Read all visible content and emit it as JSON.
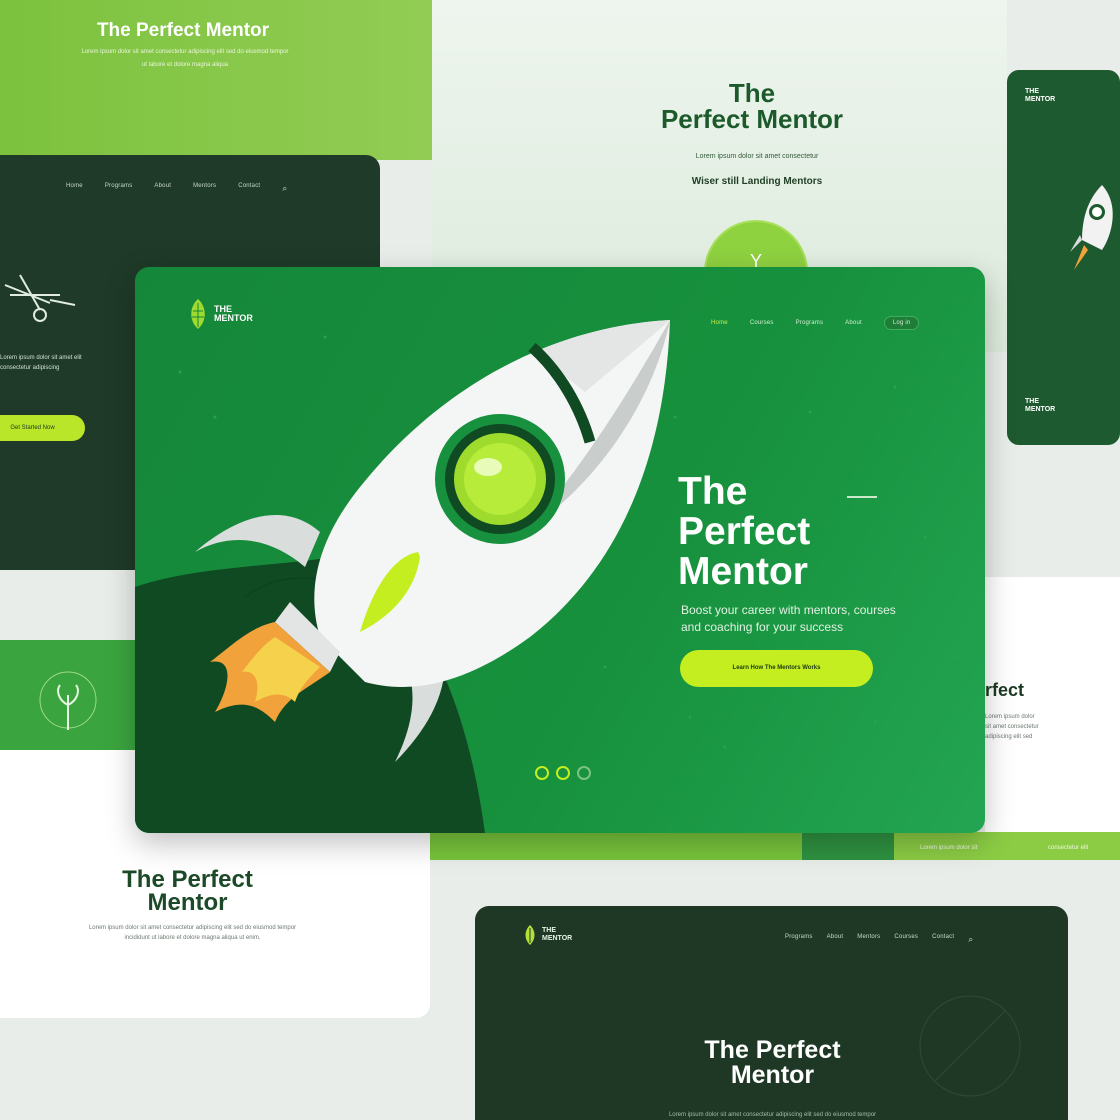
{
  "brand": {
    "title": "The Perfect Mentor",
    "logo_line1": "THE",
    "logo_line2": "MENTOR",
    "accent": "#c4ee20",
    "primary": "#17913d",
    "dark": "#1f3826"
  },
  "top_left": {
    "title": "The Perfect Mentor",
    "sub_line1": "Lorem ipsum dolor sit amet consectetur adipiscing elit sed do eiusmod tempor",
    "sub_line2": "ut labore et dolore magna aliqua"
  },
  "top_center": {
    "title_line1": "The",
    "title_line2": "Perfect Mentor",
    "tagline": "Lorem ipsum dolor sit amet consectetur",
    "subtagline": "Wiser still Landing Mentors",
    "circle_label": "Y"
  },
  "right_mobile": {
    "logo_line1": "THE",
    "logo_line2": "MENTOR"
  },
  "left_dark": {
    "nav": [
      "Home",
      "Programs",
      "About",
      "Mentors",
      "Contact"
    ],
    "text_line1": "Lorem ipsum dolor sit amet elit",
    "text_line2": "consectetur adipiscing",
    "button_label": "Get Started Now"
  },
  "bottom_left": {
    "title_line1": "The Perfect",
    "title_line2": "Mentor",
    "body_line1": "Lorem ipsum dolor sit amet consectetur adipiscing elit sed do eiusmod tempor",
    "body_line2": "incididunt ut labore et dolore magna aliqua ut enim."
  },
  "right_white": {
    "title": "rfect",
    "body_line1": "Lorem ipsum dolor",
    "body_line2": "sit amet consectetur",
    "body_line3": "adipiscing elit sed"
  },
  "strip": {
    "text1": "Lorem ipsum dolor sit",
    "text2": "consectetur elit"
  },
  "bottom_dark": {
    "logo_line1": "THE",
    "logo_line2": "MENTOR",
    "nav": [
      "Programs",
      "About",
      "Mentors",
      "Courses",
      "Contact"
    ],
    "title_line1": "The Perfect",
    "title_line2": "Mentor",
    "footer": "Lorem ipsum dolor sit amet consectetur adipiscing elit sed do eiusmod tempor"
  },
  "hero": {
    "logo_line1": "THE",
    "logo_line2": "MENTOR",
    "nav": [
      "Home",
      "Courses",
      "Programs",
      "About"
    ],
    "nav_button": "Log in",
    "title_line1": "The",
    "title_line2": "Perfect",
    "title_line3": "Mentor",
    "subtitle": "Boost your career with mentors, courses and coaching for your success",
    "cta_label": "Learn How The Mentors Works",
    "carousel_active": 2,
    "carousel_total": 3
  }
}
